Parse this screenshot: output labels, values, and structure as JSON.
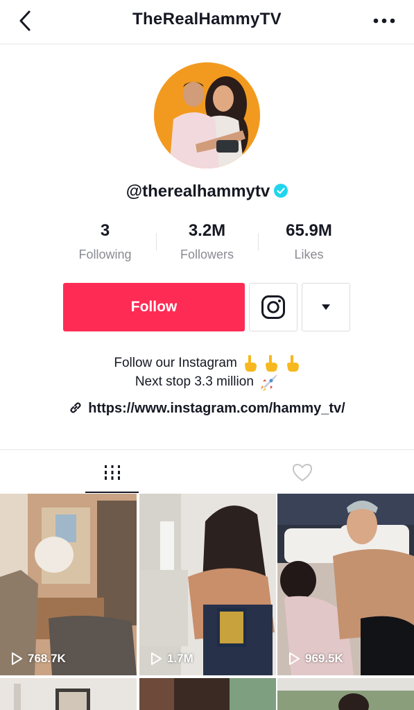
{
  "header": {
    "title": "TheRealHammyTV"
  },
  "profile": {
    "handle": "@therealhammytv",
    "verified": true,
    "stats": [
      {
        "value": "3",
        "label": "Following"
      },
      {
        "value": "3.2M",
        "label": "Followers"
      },
      {
        "value": "65.9M",
        "label": "Likes"
      }
    ]
  },
  "actions": {
    "follow_label": "Follow"
  },
  "bio": {
    "line1": "Follow our Instagram",
    "line2": "Next stop 3.3 million",
    "link": "https://www.instagram.com/hammy_tv/"
  },
  "videos": [
    {
      "views": "768.7K"
    },
    {
      "views": "1.7M"
    },
    {
      "views": "969.5K"
    }
  ],
  "colors": {
    "accent": "#fe2c55",
    "verified": "#20d5ec",
    "avatar_bg": "#f29a1f"
  },
  "icons": {
    "back": "chevron-left-icon",
    "more": "ellipsis-icon",
    "instagram": "instagram-icon",
    "dropdown": "caret-down-icon",
    "videos_tab": "grid-icon",
    "liked_tab": "heart-icon",
    "link": "link-icon",
    "play": "play-icon"
  }
}
